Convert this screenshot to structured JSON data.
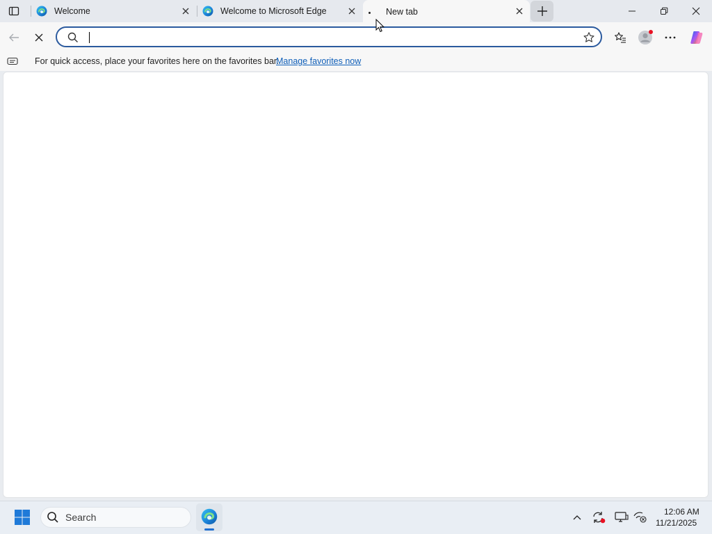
{
  "tabs": [
    {
      "title": "Welcome",
      "icon": "edge-logo-icon",
      "active": false
    },
    {
      "title": "Welcome to Microsoft Edge",
      "icon": "edge-logo-icon",
      "active": false
    },
    {
      "title": "New tab",
      "icon": "loading-dot-icon",
      "active": true
    }
  ],
  "address_bar": {
    "value": "",
    "placeholder": ""
  },
  "favorites_bar": {
    "message": "For quick access, place your favorites here on the favorites bar.",
    "link_label": "Manage favorites now"
  },
  "taskbar": {
    "search_placeholder": "Search",
    "time": "12:06 AM",
    "date": "11/21/2025"
  },
  "colors": {
    "accent": "#2b5a9e",
    "link": "#0f5fb8",
    "notification": "#e81123"
  }
}
